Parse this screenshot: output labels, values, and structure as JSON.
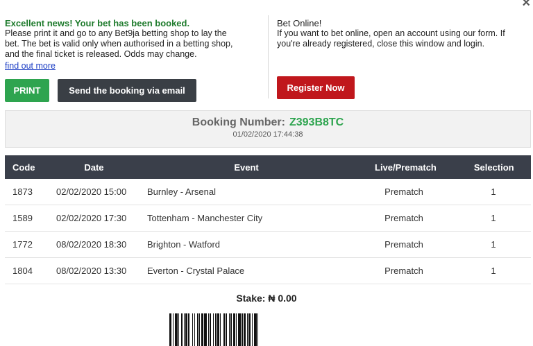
{
  "window": {
    "close_glyph": "×"
  },
  "left": {
    "headline": "Excellent news! Your bet has been booked.",
    "desc_lines": [
      "Please print it and go to any Bet9ja betting shop to lay the",
      "bet. The bet is valid only when authorised in a betting shop,",
      "and the final ticket is released. Odds may change."
    ],
    "link": "find out more",
    "print_label": "PRINT",
    "email_label": "Send the booking via email"
  },
  "right": {
    "title": "Bet Online!",
    "desc_lines": [
      "If you want to bet online, open an account using our form. If",
      "you're already registered, close this window and login."
    ],
    "register_label": "Register Now"
  },
  "booking": {
    "label": "Booking Number:",
    "number": "Z393B8TC",
    "datetime": "01/02/2020 17:44:38"
  },
  "table": {
    "headers": [
      "Code",
      "Date",
      "Event",
      "Live/Prematch",
      "Selection"
    ],
    "rows": [
      {
        "code": "1873",
        "date": "02/02/2020 15:00",
        "event": "Burnley - Arsenal",
        "live": "Prematch",
        "selection": "1"
      },
      {
        "code": "1589",
        "date": "02/02/2020 17:30",
        "event": "Tottenham - Manchester City",
        "live": "Prematch",
        "selection": "1"
      },
      {
        "code": "1772",
        "date": "08/02/2020 18:30",
        "event": "Brighton - Watford",
        "live": "Prematch",
        "selection": "1"
      },
      {
        "code": "1804",
        "date": "08/02/2020 13:30",
        "event": "Everton - Crystal Palace",
        "live": "Prematch",
        "selection": "1"
      }
    ]
  },
  "stake": "Stake: ₦ 0.00",
  "colors": {
    "headline_green": "#1e7b2c",
    "print_green": "#2ea44f",
    "email_dark": "#3a3f45",
    "register_red": "#c0171c",
    "table_header": "#3a3f4a"
  }
}
